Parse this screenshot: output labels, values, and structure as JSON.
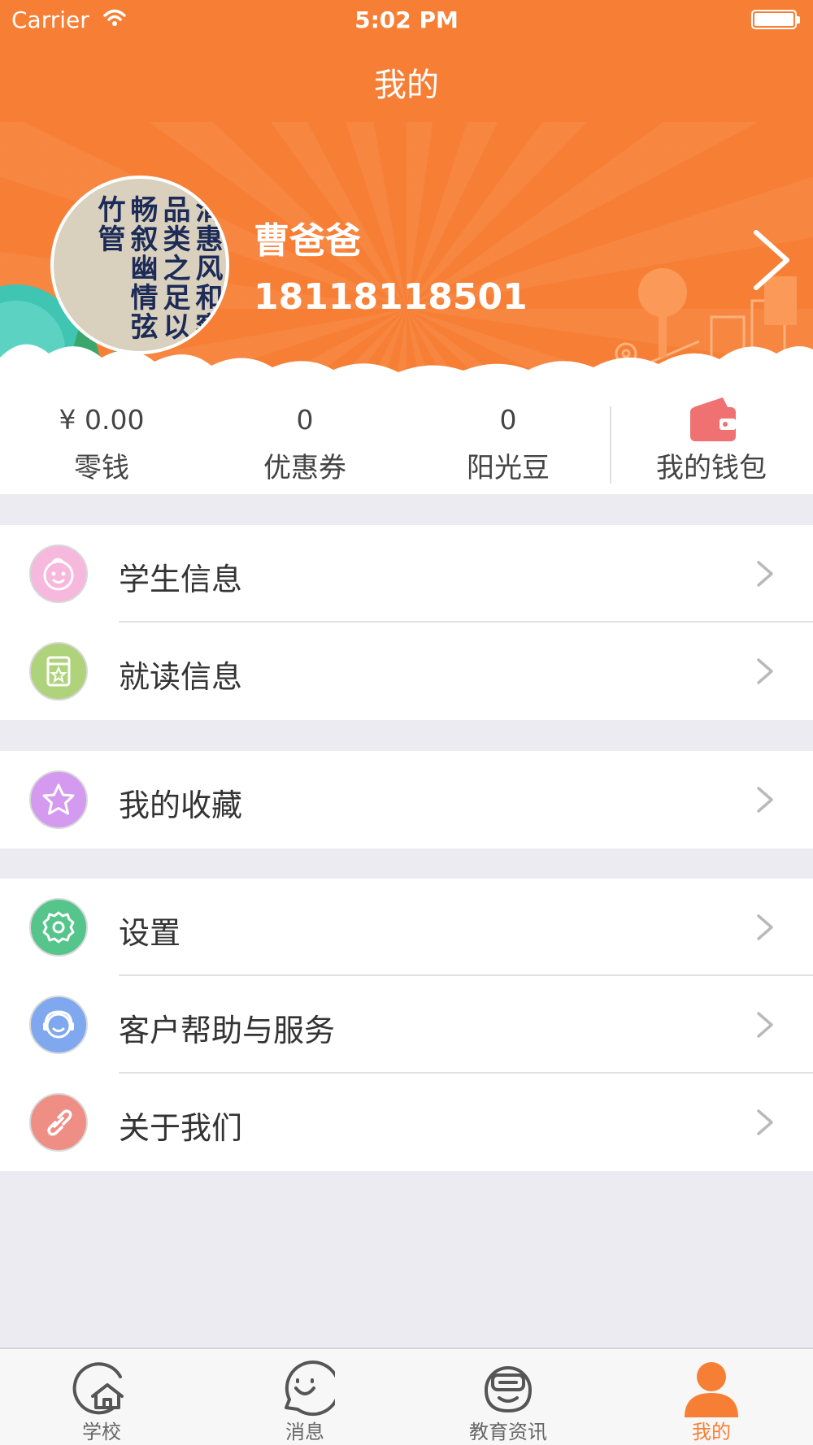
{
  "status_bar": {
    "carrier": "Carrier",
    "time": "5:02 PM"
  },
  "nav": {
    "title": "我的"
  },
  "profile": {
    "name": "曹爸爸",
    "phone": "18118118501",
    "avatar_text": "清惠风和察品类之足以畅叙幽情弦竹管"
  },
  "stats": [
    {
      "value": "¥ 0.00",
      "label": "零钱"
    },
    {
      "value": "0",
      "label": "优惠券"
    },
    {
      "value": "0",
      "label": "阳光豆"
    },
    {
      "label": "我的钱包"
    }
  ],
  "menu": {
    "group1": [
      {
        "label": "学生信息",
        "icon": "baby-face-icon",
        "color": "#f6b8dc"
      },
      {
        "label": "就读信息",
        "icon": "id-card-icon",
        "color": "#aed37a"
      }
    ],
    "group2": [
      {
        "label": "我的收藏",
        "icon": "star-icon",
        "color": "#d39af0"
      }
    ],
    "group3": [
      {
        "label": "设置",
        "icon": "gear-icon",
        "color": "#55c58b"
      },
      {
        "label": "客户帮助与服务",
        "icon": "headset-icon",
        "color": "#7fa8ee"
      },
      {
        "label": "关于我们",
        "icon": "link-icon",
        "color": "#ef8e84"
      }
    ]
  },
  "tabbar": [
    {
      "label": "学校",
      "icon": "home-icon"
    },
    {
      "label": "消息",
      "icon": "smile-chat-icon"
    },
    {
      "label": "教育资讯",
      "icon": "news-robot-icon"
    },
    {
      "label": "我的",
      "icon": "person-icon",
      "active": true
    }
  ],
  "colors": {
    "brand": "#f77f35",
    "background": "#ecebf1"
  }
}
